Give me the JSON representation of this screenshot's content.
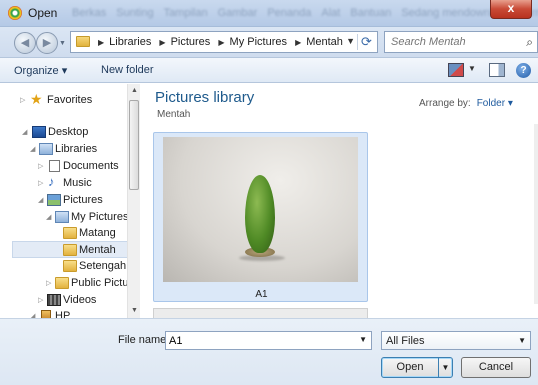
{
  "window": {
    "title": "Open",
    "close_glyph": "x",
    "ghost_menu": [
      "Berkas",
      "Sunting",
      "Tampilan",
      "Gambar",
      "Penanda",
      "Alat",
      "Bantuan",
      "Sedang mendownload informasi"
    ]
  },
  "address": {
    "crumbs": [
      "Libraries",
      "Pictures",
      "My Pictures",
      "Mentah"
    ],
    "search_placeholder": "Search Mentah"
  },
  "toolbar": {
    "organize_label": "Organize ▾",
    "new_folder_label": "New folder"
  },
  "nav": {
    "items": [
      {
        "label": "Favorites",
        "icon": "star-icon"
      },
      {
        "label": "Desktop",
        "icon": "desktop-icon"
      },
      {
        "label": "Libraries",
        "icon": "library-icon"
      },
      {
        "label": "Documents",
        "icon": "document-icon"
      },
      {
        "label": "Music",
        "icon": "music-icon"
      },
      {
        "label": "Pictures",
        "icon": "pictures-icon"
      },
      {
        "label": "My Pictures",
        "icon": "folder-icon"
      },
      {
        "label": "Matang",
        "icon": "folder-icon"
      },
      {
        "label": "Mentah",
        "icon": "folder-icon",
        "selected": true
      },
      {
        "label": "Setengah M",
        "icon": "folder-icon"
      },
      {
        "label": "Public Pictur",
        "icon": "folder-icon"
      },
      {
        "label": "Videos",
        "icon": "videos-icon"
      },
      {
        "label": "HP",
        "icon": "user-icon"
      }
    ]
  },
  "content": {
    "library_title": "Pictures library",
    "library_subtitle": "Mentah",
    "arrange_label": "Arrange by:",
    "arrange_value": "Folder ▾",
    "files": [
      {
        "name": "A1"
      }
    ]
  },
  "bottom": {
    "filename_label": "File name:",
    "filename_value": "A1",
    "filetype_value": "All Files",
    "open_label": "Open",
    "cancel_label": "Cancel"
  },
  "colors": {
    "accent": "#1e5a8c",
    "selection": "#dbe8f8",
    "close_button": "#c94a36"
  }
}
